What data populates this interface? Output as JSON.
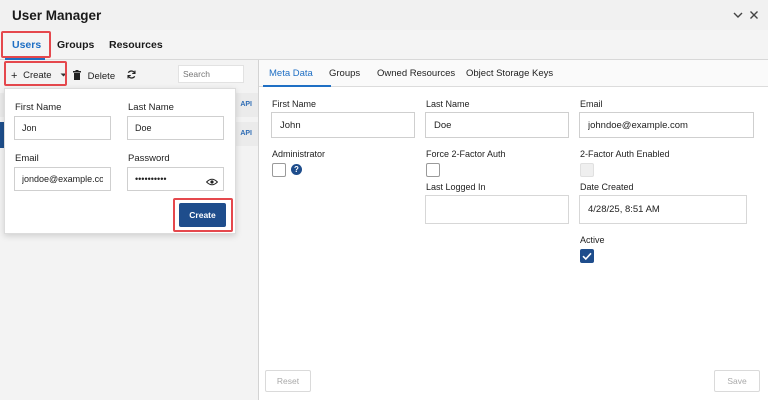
{
  "window": {
    "title": "User Manager"
  },
  "top_tabs": [
    {
      "label": "Users",
      "active": true
    },
    {
      "label": "Groups",
      "active": false
    },
    {
      "label": "Resources",
      "active": false
    }
  ],
  "left_toolbar": {
    "create_label": "Create",
    "delete_label": "Delete",
    "search_placeholder": "Search"
  },
  "user_rows": [
    {
      "tag": "API"
    },
    {
      "tag": "API"
    }
  ],
  "create_popup": {
    "first_name_label": "First Name",
    "first_name_value": "Jon",
    "last_name_label": "Last Name",
    "last_name_value": "Doe",
    "email_label": "Email",
    "email_value": "jondoe@example.com",
    "password_label": "Password",
    "password_masked": "••••••••••",
    "create_button": "Create"
  },
  "detail_tabs": [
    {
      "label": "Meta Data",
      "active": true
    },
    {
      "label": "Groups",
      "active": false
    },
    {
      "label": "Owned Resources",
      "active": false
    },
    {
      "label": "Object Storage Keys",
      "active": false
    }
  ],
  "meta": {
    "first_name_label": "First Name",
    "first_name_value": "John",
    "last_name_label": "Last Name",
    "last_name_value": "Doe",
    "email_label": "Email",
    "email_value": "johndoe@example.com",
    "administrator_label": "Administrator",
    "administrator_checked": false,
    "force_2fa_label": "Force 2-Factor Auth",
    "force_2fa_checked": false,
    "twofa_enabled_label": "2-Factor Auth Enabled",
    "twofa_enabled_checked": false,
    "last_logged_in_label": "Last Logged In",
    "last_logged_in_value": "",
    "date_created_label": "Date Created",
    "date_created_value": "4/28/25, 8:51 AM",
    "active_label": "Active",
    "active_checked": true
  },
  "footer": {
    "reset_label": "Reset",
    "save_label": "Save"
  },
  "colors": {
    "accent": "#1f6fc4",
    "primary_button": "#1e4d8c",
    "highlight": "#e5484d"
  }
}
